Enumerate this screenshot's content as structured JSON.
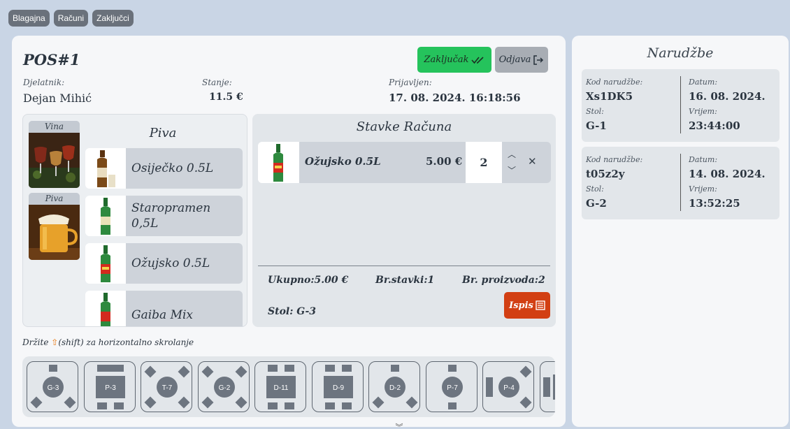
{
  "nav": {
    "tabs": [
      {
        "label": "Blagajna"
      },
      {
        "label": "Računi"
      },
      {
        "label": "Zaključci"
      }
    ]
  },
  "pos": {
    "title": "POS#1",
    "zakljucak_label": "Zaključak",
    "odjava_label": "Odjava",
    "employee": {
      "label": "Djelatnik:",
      "value": "Dejan Mihić"
    },
    "balance": {
      "label": "Stanje:",
      "value": "11.5 €"
    },
    "logged_in": {
      "label": "Prijavljen:",
      "value": "17. 08. 2024. 16:18:56"
    }
  },
  "categories": {
    "heading": "Piva",
    "items": [
      {
        "label": "Vina",
        "icon": "wine-image"
      },
      {
        "label": "Piva",
        "icon": "beer-image"
      }
    ]
  },
  "products": [
    {
      "name": "Osiječko 0.5L"
    },
    {
      "name": "Staropramen 0,5L"
    },
    {
      "name": "Ožujsko 0.5L"
    },
    {
      "name": "Gaiba Mix"
    }
  ],
  "bill": {
    "heading": "Stavke Računa",
    "items": [
      {
        "name": "Ožujsko 0.5L",
        "price": "5.00 €",
        "qty": "2"
      }
    ],
    "total": "Ukupno:5.00 €",
    "item_count": "Br.stavki:1",
    "product_count": "Br. proizvoda:2",
    "table": "Stol: G-3",
    "print_label": "Ispis"
  },
  "hint": {
    "prefix": "Držite",
    "suffix": "(shift) za horizontalno skrolanje",
    "arrow": "⇧"
  },
  "tables": [
    {
      "label": "G-3",
      "shape": "round-diagonal"
    },
    {
      "label": "P-3",
      "shape": "rect"
    },
    {
      "label": "T-7",
      "shape": "round-diagonal-4"
    },
    {
      "label": "G-2",
      "shape": "round-diagonal-4"
    },
    {
      "label": "D-11",
      "shape": "rect-4"
    },
    {
      "label": "D-9",
      "shape": "rect-4"
    },
    {
      "label": "D-2",
      "shape": "round-diagonal"
    },
    {
      "label": "P-7",
      "shape": "round-vertical"
    },
    {
      "label": "P-4",
      "shape": "round-side"
    }
  ],
  "orders": {
    "title": "Narudžbe",
    "labels": {
      "code": "Kod narudžbe:",
      "date": "Datum:",
      "table": "Stol:",
      "time": "Vrijem:"
    },
    "items": [
      {
        "code": "Xs1DK5",
        "date": "16. 08. 2024.",
        "table": "G-1",
        "time": "23:44:00"
      },
      {
        "code": "t05z2y",
        "date": "14. 08. 2024.",
        "table": "G-2",
        "time": "13:52:25"
      }
    ]
  },
  "colors": {
    "accent_green": "#25c35c",
    "print_red": "#d23f13",
    "panel": "#f6f7f9",
    "background": "#c9d5e5"
  }
}
